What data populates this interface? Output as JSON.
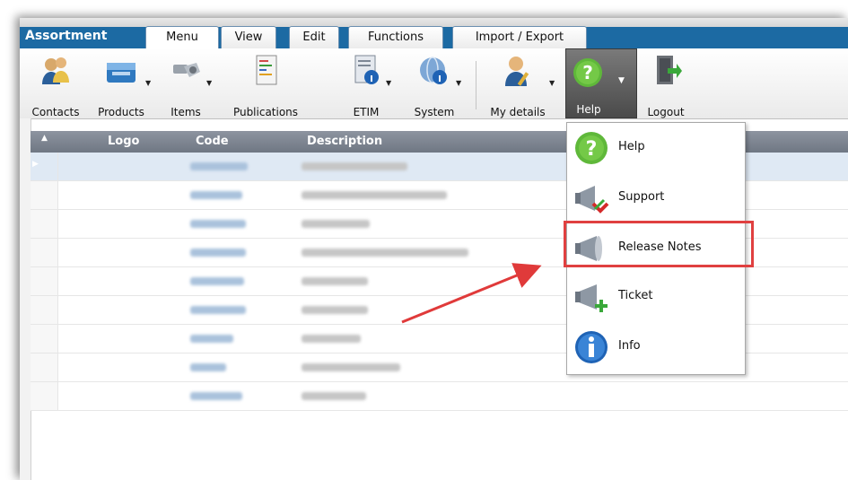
{
  "app": {
    "title": "Assortment"
  },
  "tabs": [
    "Menu",
    "View",
    "Edit",
    "Functions",
    "Import / Export"
  ],
  "toolbar": {
    "contacts": "Contacts",
    "products": "Products",
    "items": "Items",
    "publications": "Publications",
    "etim": "ETIM",
    "system": "System",
    "my_details": "My details",
    "help": "Help",
    "logout": "Logout"
  },
  "grid": {
    "columns": [
      "Logo",
      "Code",
      "Description"
    ]
  },
  "help_menu": {
    "items": [
      "Help",
      "Support",
      "Release Notes",
      "Ticket",
      "Info"
    ]
  },
  "colors": {
    "accent": "#1c6aa3",
    "highlight": "#e04040"
  }
}
